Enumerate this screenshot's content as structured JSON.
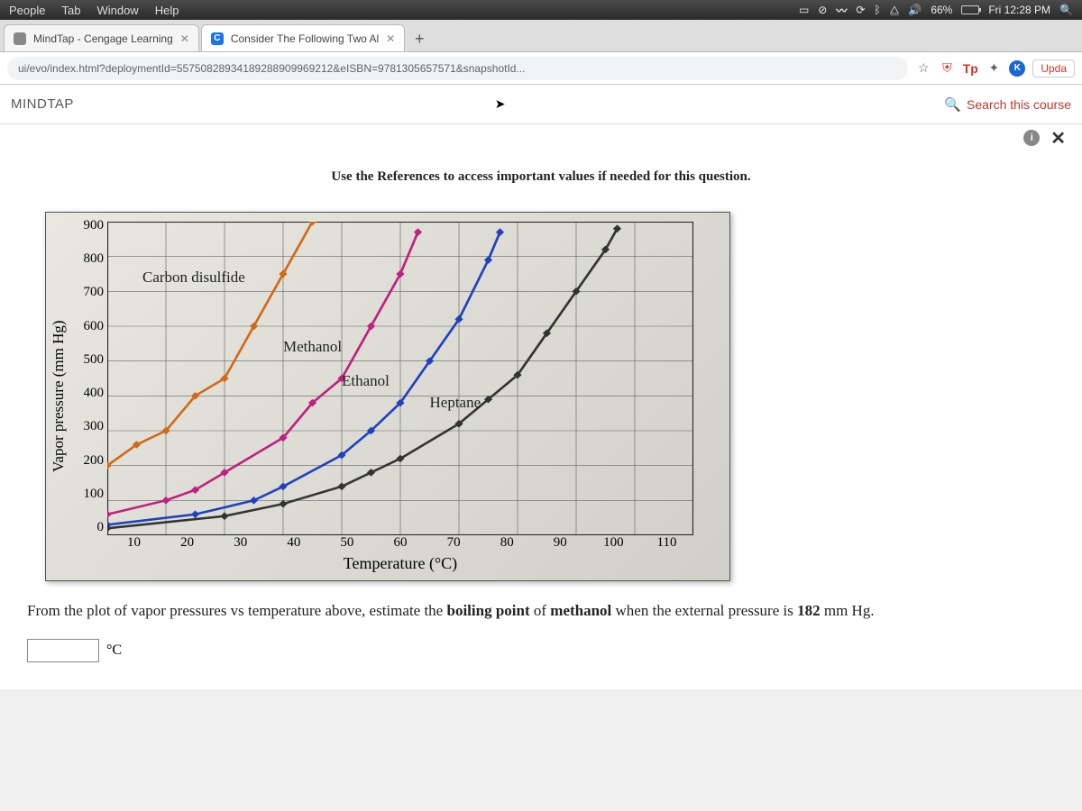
{
  "menubar": {
    "items": [
      "People",
      "Tab",
      "Window",
      "Help"
    ],
    "battery_pct": "66%",
    "clock": "Fri 12:28 PM"
  },
  "tabs": {
    "items": [
      {
        "title": "MindTap - Cengage Learning",
        "favicon": ""
      },
      {
        "title": "Consider The Following Two Al",
        "favicon": "C"
      }
    ]
  },
  "urlbar": {
    "text": "ui/evo/index.html?deploymentId=55750828934189288909969212&eISBN=9781305657571&snapshotId...",
    "update_label": "Upda",
    "k_badge": "K"
  },
  "mindtap": {
    "title": "MINDTAP",
    "search_label": "Search this course"
  },
  "content": {
    "hint": "Use the References to access important values if needed for this question.",
    "question_prefix": "From the plot of vapor pressures vs temperature above, estimate the ",
    "question_bold1": "boiling point",
    "question_mid": " of ",
    "question_bold2": "methanol",
    "question_suffix": " when the external pressure is ",
    "question_bold3": "182",
    "question_end": " mm Hg.",
    "unit": "°C"
  },
  "chart_data": {
    "type": "line",
    "title": "",
    "xlabel": "Temperature (°C)",
    "ylabel": "Vapor pressure (mm Hg)",
    "xlim": [
      10,
      110
    ],
    "ylim": [
      0,
      900
    ],
    "x_ticks": [
      10,
      20,
      30,
      40,
      50,
      60,
      70,
      80,
      90,
      100,
      110
    ],
    "y_ticks": [
      0,
      100,
      200,
      300,
      400,
      500,
      600,
      700,
      800,
      900
    ],
    "series": [
      {
        "name": "Carbon disulfide",
        "color": "#d06a1a",
        "x": [
          10,
          15,
          20,
          25,
          30,
          35,
          40,
          45
        ],
        "y": [
          200,
          260,
          300,
          400,
          450,
          600,
          750,
          900
        ]
      },
      {
        "name": "Methanol",
        "color": "#c02080",
        "x": [
          10,
          20,
          25,
          30,
          40,
          45,
          50,
          55,
          60,
          63
        ],
        "y": [
          60,
          100,
          130,
          180,
          280,
          380,
          450,
          600,
          750,
          870
        ]
      },
      {
        "name": "Ethanol",
        "color": "#2040c0",
        "x": [
          10,
          25,
          35,
          40,
          50,
          55,
          60,
          65,
          70,
          75,
          77
        ],
        "y": [
          30,
          60,
          100,
          140,
          230,
          300,
          380,
          500,
          620,
          790,
          870
        ]
      },
      {
        "name": "Heptane",
        "color": "#333333",
        "x": [
          10,
          30,
          40,
          50,
          55,
          60,
          70,
          75,
          80,
          85,
          90,
          95,
          97
        ],
        "y": [
          20,
          55,
          90,
          140,
          180,
          220,
          320,
          390,
          460,
          580,
          700,
          820,
          880
        ]
      }
    ],
    "series_label_pos": {
      "Carbon disulfide": {
        "left": "6%",
        "top": "15%"
      },
      "Methanol": {
        "left": "30%",
        "top": "37%"
      },
      "Ethanol": {
        "left": "40%",
        "top": "48%"
      },
      "Heptane": {
        "left": "55%",
        "top": "55%"
      }
    }
  }
}
